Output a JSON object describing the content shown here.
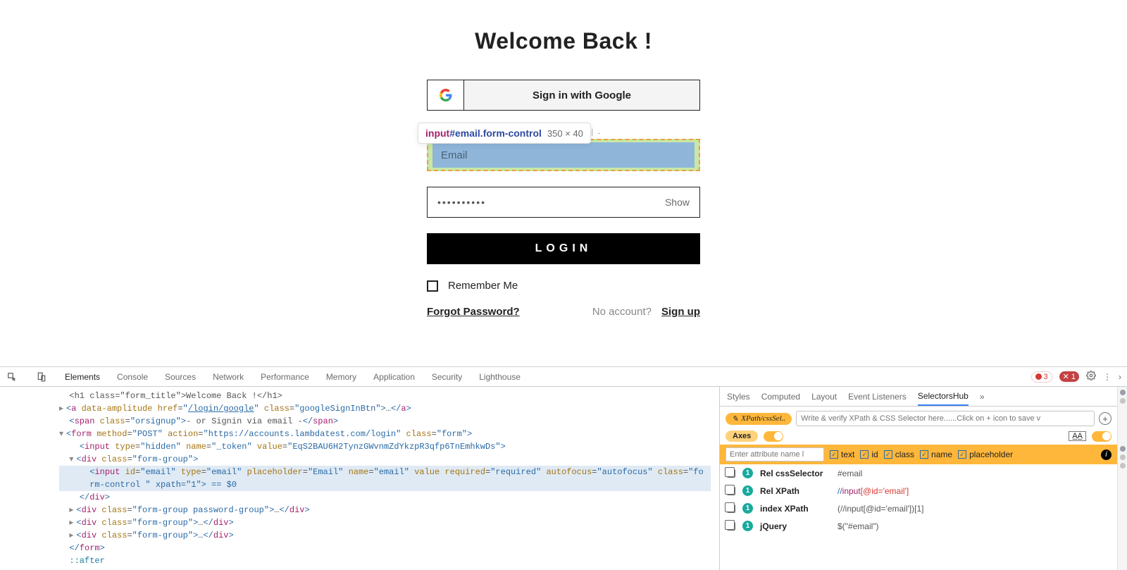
{
  "login": {
    "title": "Welcome Back !",
    "google_label": "Sign in with Google",
    "or_signin": "il -",
    "email_placeholder": "Email",
    "password_value": "••••••••••",
    "show_label": "Show",
    "login_label": "LOGIN",
    "remember_label": "Remember Me",
    "forgot_label": "Forgot Password?",
    "no_account_label": "No account?",
    "signup_label": "Sign up"
  },
  "tooltip": {
    "tag": "input",
    "selector": "#email.form-control",
    "dims": "350 × 40"
  },
  "devtools": {
    "tabs": [
      "Elements",
      "Console",
      "Sources",
      "Network",
      "Performance",
      "Memory",
      "Application",
      "Security",
      "Lighthouse"
    ],
    "error_count": "3",
    "warn_count": "1",
    "elements": {
      "l0_pre": "<h1 class=\"form_title\">Welcome Back !</h1>",
      "l1_href": "/login/google",
      "l2": "- or Signin via email -",
      "l3_action": "https://accounts.lambdatest.com/login",
      "l4_token": "EqS2BAU6H2TynzGWvnmZdYkzpR3qfp6TnEmhkwDs",
      "hl_prefix": "fo",
      "hl_line2": "rm-control \" xpath=\"1\"> == $0"
    },
    "side_tabs": [
      "Styles",
      "Computed",
      "Layout",
      "Event Listeners",
      "SelectorsHub"
    ],
    "sh": {
      "badge": "XPath/cssSel..",
      "input_ph": "Write & verify XPath & CSS Selector here......Click on + icon to save v",
      "axes": "Axes",
      "aa": "A̲A̲",
      "attr_ph": "Enter attribute name l",
      "checks": [
        "text",
        "id",
        "class",
        "name",
        "placeholder"
      ],
      "rows": [
        {
          "label": "Rel cssSelector",
          "plain": "#email"
        },
        {
          "label": "Rel XPath",
          "xpath1": "//",
          "xpath2": "input",
          "xpath3": "[@id='email']"
        },
        {
          "label": "index XPath",
          "plain": "(//input[@id='email'])[1]"
        },
        {
          "label": "jQuery",
          "plain": "$(\"#email\")"
        }
      ]
    }
  }
}
